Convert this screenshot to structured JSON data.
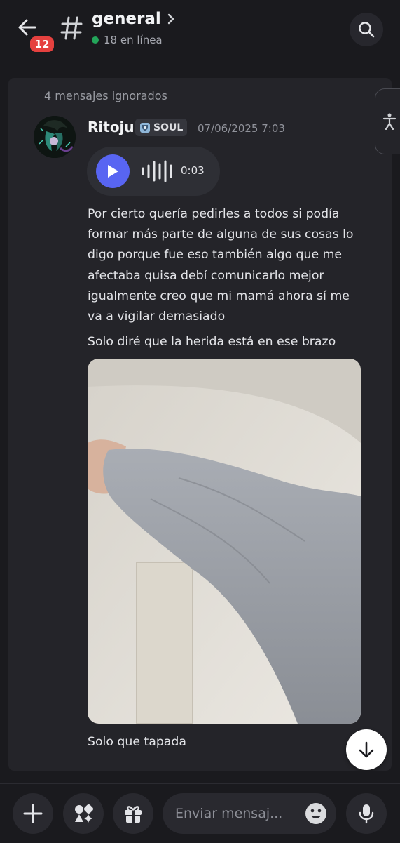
{
  "header": {
    "back_badge": "12",
    "channel_name": "general",
    "online_status": "18 en línea"
  },
  "messages": {
    "ignored_notice": "4 mensajes ignorados",
    "author": "Ritoju",
    "tag_label": "SOUL",
    "timestamp": "07/06/2025 7:03",
    "voice_duration": "0:03",
    "text_1": "Por cierto quería pedirles a todos si podía formar más parte de alguna de sus cosas lo digo porque fue eso también algo que me afectaba quisa debí comunicarlo mejor igualmente creo que mi mamá ahora sí me va a vigilar demasiado",
    "text_2": "Solo diré que la herida está en ese brazo",
    "text_3": "Solo que tapada"
  },
  "composer": {
    "placeholder": "Enviar mensaj..."
  },
  "colors": {
    "accent": "#5865f2",
    "badge": "#e5413f",
    "online": "#23a55a"
  }
}
